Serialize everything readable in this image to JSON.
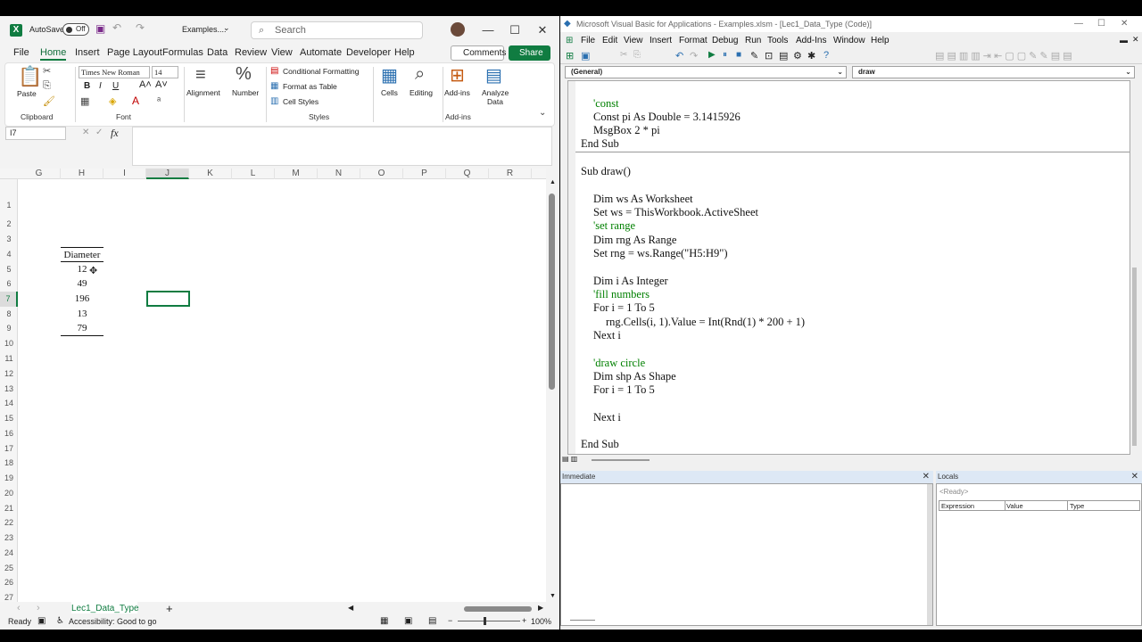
{
  "excel": {
    "autosave_label": "AutoSave",
    "autosave_state": "Off",
    "filename": "Examples....",
    "search_placeholder": "Search",
    "menu_tabs": [
      "File",
      "Home",
      "Insert",
      "Page Layout",
      "Formulas",
      "Data",
      "Review",
      "View",
      "Automate",
      "Developer",
      "Help"
    ],
    "active_tab": "Home",
    "comments_label": "Comments",
    "share_label": "Share",
    "ribbon": {
      "paste": "Paste",
      "clipboard": "Clipboard",
      "font_name": "Times New Roman",
      "font_size": "14",
      "font_group": "Font",
      "alignment": "Alignment",
      "number": "Number",
      "conditional_formatting": "Conditional Formatting",
      "format_as_table": "Format as Table",
      "cell_styles": "Cell Styles",
      "styles_group": "Styles",
      "cells": "Cells",
      "editing": "Editing",
      "addins": "Add-ins",
      "addins_group": "Add-ins",
      "analyze_data_1": "Analyze",
      "analyze_data_2": "Data",
      "bold": "B",
      "italic": "I",
      "underline": "U"
    },
    "namebox": "I7",
    "fx": "fx",
    "columns": [
      "G",
      "H",
      "I",
      "J",
      "K",
      "L",
      "M",
      "N",
      "O",
      "P",
      "Q",
      "R"
    ],
    "rows": [
      "1",
      "2",
      "3",
      "4",
      "5",
      "6",
      "7",
      "8",
      "9",
      "10",
      "11",
      "12",
      "13",
      "14",
      "15",
      "16",
      "17",
      "18",
      "19",
      "20",
      "21",
      "22",
      "23",
      "24",
      "25",
      "26",
      "27"
    ],
    "table_header": "Diameter",
    "table_values": [
      "12",
      "49",
      "196",
      "13",
      "79"
    ],
    "sheet_tab": "Lec1_Data_Type",
    "status_ready": "Ready",
    "accessibility": "Accessibility: Good to go",
    "zoom": "100%"
  },
  "vba": {
    "title": "Microsoft Visual Basic for Applications - Examples.xlsm - [Lec1_Data_Type (Code)]",
    "menu": [
      "File",
      "Edit",
      "View",
      "Insert",
      "Format",
      "Debug",
      "Run",
      "Tools",
      "Add-Ins",
      "Window",
      "Help"
    ],
    "object_combo": "(General)",
    "proc_combo": "draw",
    "code_lines": [
      "'const",
      "Const pi As Double = 3.1415926",
      "MsgBox 2 * pi",
      "End Sub",
      "Sub draw()",
      "Dim ws As Worksheet",
      "Set ws = ThisWorkbook.ActiveSheet",
      "'set range",
      "Dim rng As Range",
      "Set rng = ws.Range(\"H5:H9\")",
      "Dim i As Integer",
      "'fill numbers",
      "For i = 1 To 5",
      "rng.Cells(i, 1).Value = Int(Rnd(1) * 200 + 1)",
      "Next i",
      "'draw circle",
      "Dim shp As Shape",
      "For i = 1 To 5",
      "Next i",
      "End Sub"
    ],
    "immediate_title": "Immediate",
    "locals_title": "Locals",
    "locals_status": "<Ready>",
    "locals_columns": [
      "Expression",
      "Value",
      "Type"
    ]
  }
}
